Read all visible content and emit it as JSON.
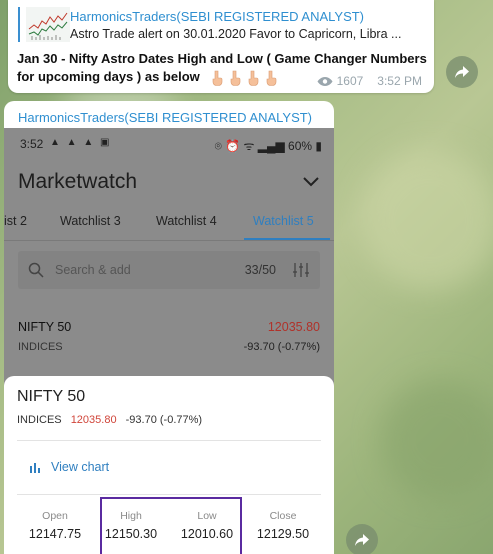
{
  "message1": {
    "reply_author": "HarmonicsTraders(SEBI REGISTERED ANALYST)",
    "reply_text": "Astro Trade alert on 30.01.2020   Favor to Capricorn, Libra ...",
    "text": "Jan 30 - Nifty Astro Dates High and Low ( Game Changer Numbers for upcoming days ) as below",
    "emoji_icon": "pointing-down-hand-icon",
    "views": "1607",
    "time": "3:52 PM"
  },
  "message2": {
    "author": "HarmonicsTraders(SEBI REGISTERED ANALYST)",
    "screenshot": {
      "status_time": "3:52",
      "status_left_icons": "▲ ▲ ▲ ▣",
      "status_right": "⌾ ⏰ ᯤ ▂▄▆ 60% ▮",
      "title": "Marketwatch",
      "tabs": [
        {
          "label": "ist 2"
        },
        {
          "label": "Watchlist 3"
        },
        {
          "label": "Watchlist 4"
        },
        {
          "label": "Watchlist 5",
          "active": true
        }
      ],
      "search_placeholder": "Search & add",
      "search_count": "33/50",
      "row": {
        "name": "NIFTY 50",
        "segment": "INDICES",
        "price": "12035.80",
        "change": "-93.70 (-0.77%)"
      },
      "sheet": {
        "name": "NIFTY 50",
        "segment": "INDICES",
        "price": "12035.80",
        "change": "-93.70 (-0.77%)",
        "view_chart": "View chart",
        "ohlc": [
          {
            "label": "Open",
            "value": "12147.75"
          },
          {
            "label": "High",
            "value": "12150.30"
          },
          {
            "label": "Low",
            "value": "12010.60"
          },
          {
            "label": "Close",
            "value": "12129.50"
          }
        ]
      }
    }
  },
  "colors": {
    "author_blue": "#2f8fd0",
    "accent_blue": "#2f7fc0",
    "price_red": "#d0453a",
    "highlight_purple": "#5a2aa0"
  }
}
